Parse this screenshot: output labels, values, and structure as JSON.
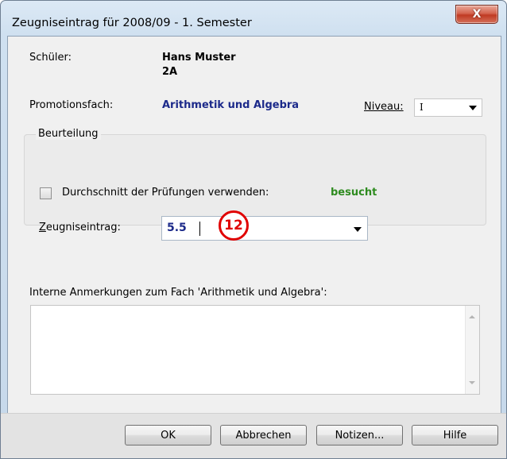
{
  "window": {
    "title": "Zeugniseintrag für 2008/09 - 1. Semester",
    "close_symbol": "X"
  },
  "student": {
    "label": "Schüler:",
    "name": "Hans Muster",
    "class": "2A"
  },
  "subject": {
    "label": "Promotionsfach:",
    "value": "Arithmetik und Algebra",
    "niveau_label": "Niveau:",
    "niveau_value": "I"
  },
  "assessment": {
    "group_label": "Beurteilung",
    "average_checkbox_label": "Durchschnitt der Prüfungen verwenden:",
    "average_checked": false,
    "status": "besucht",
    "entry_label": "Zeugniseintrag:",
    "entry_value": "5.5",
    "badge": "12"
  },
  "notes": {
    "label": "Interne Anmerkungen zum Fach 'Arithmetik und Algebra':",
    "value": ""
  },
  "buttons": {
    "ok": "OK",
    "cancel": "Abbrechen",
    "notes": "Notizen...",
    "help": "Hilfe"
  },
  "colors": {
    "subject_text": "#1c2a8a",
    "status_text": "#2e8b1f",
    "badge": "#e00000",
    "close_button": "#c03a22"
  }
}
